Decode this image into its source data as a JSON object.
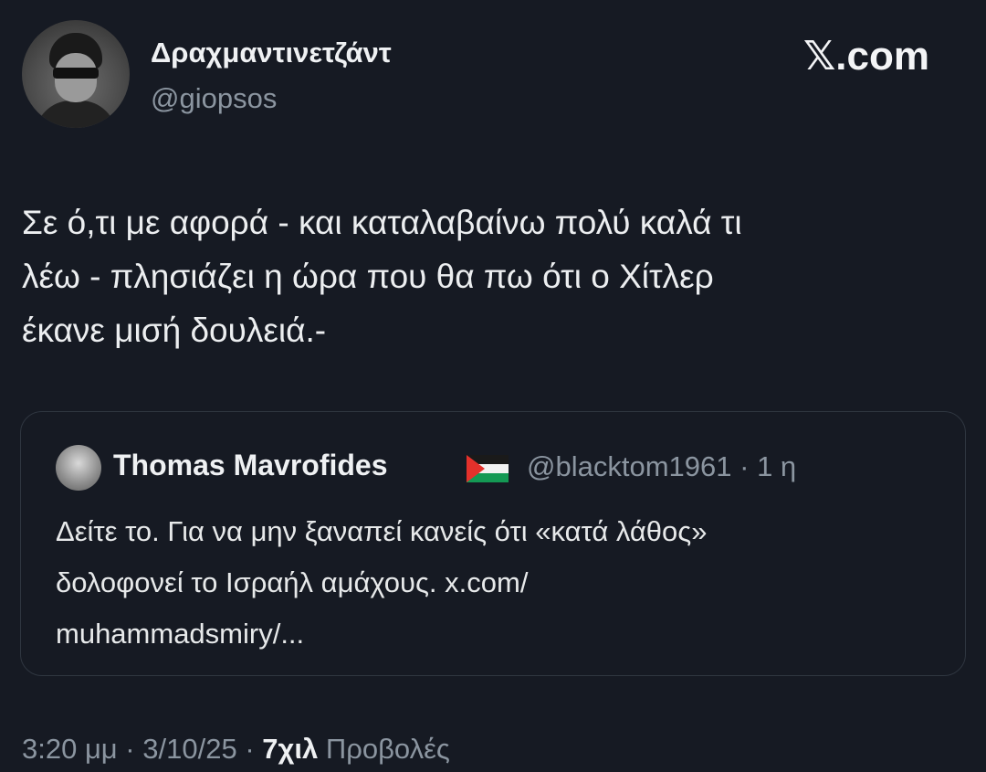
{
  "tweet": {
    "author": {
      "display_name": "Δραχμαντινετζάντ",
      "handle": "@giopsos"
    },
    "brand": "𝕏.com",
    "text_lines": [
      "Σε ό,τι με αφορά - και καταλαβαίνω πολύ καλά τι",
      "λέω - πλησιάζει η ώρα που θα πω ότι ο Χίτλερ",
      "έκανε μισή δουλειά.-"
    ],
    "quoted": {
      "author_name": "Thomas Mavrofides",
      "handle": "@blacktom1961",
      "separator": "·",
      "time_ago": "1 η",
      "text_lines": [
        "Δείτε το. Για να μην ξαναπεί κανείς ότι «κατά λάθος»",
        "δολοφονεί το Ισραήλ αμάχους. x.com/",
        "muhammadsmiry/..."
      ]
    },
    "footer": {
      "time": "3:20 μμ",
      "separator": "·",
      "date": "3/10/25",
      "views_count": "7χιλ",
      "views_label": "Προβολές"
    }
  }
}
